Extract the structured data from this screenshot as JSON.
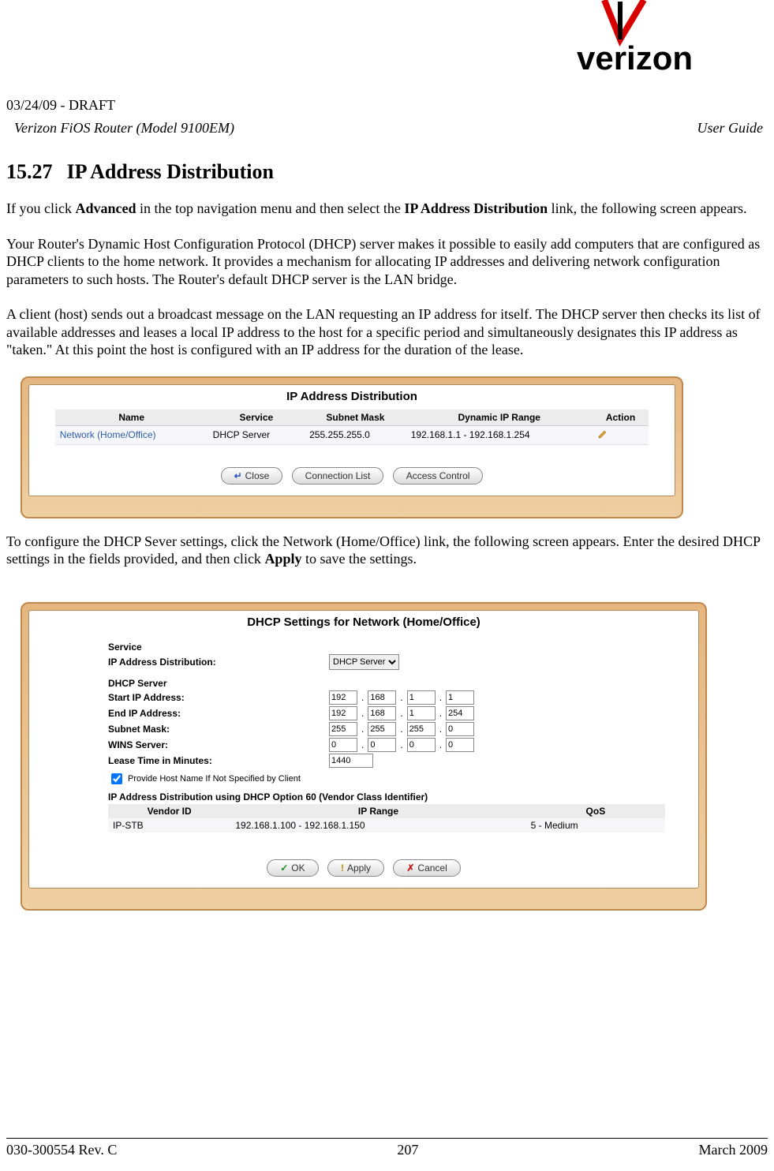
{
  "header": {
    "draft": "03/24/09 - DRAFT",
    "product": "Verizon FiOS Router (Model 9100EM)",
    "doc_type": "User Guide"
  },
  "section": {
    "number": "15.27",
    "title": "IP Address Distribution"
  },
  "body": {
    "p1a": "If you click ",
    "p1b": "Advanced",
    "p1c": " in the top navigation menu and then select the ",
    "p1d": "IP Address Distribution",
    "p1e": " link, the following screen appears.",
    "p2": "Your Router's Dynamic Host Configuration Protocol (DHCP) server makes it possible to easily add computers that are configured as DHCP clients to the home network. It provides a mechanism for allocating IP addresses and delivering network configuration parameters to such hosts. The Router's default DHCP server is the LAN bridge.",
    "p3": "A client (host) sends out a broadcast message on the LAN requesting an IP address for itself. The DHCP server then checks its list of available addresses and leases a local IP address to the host for a specific period and simultaneously designates this IP address as \"taken.\" At this point the host is configured with an IP address for the duration of the lease.",
    "p4a": "To configure the DHCP Sever settings, click the Network (Home/Office) link, the following screen appears. Enter the desired DHCP settings in the fields provided, and then click ",
    "p4b": "Apply",
    "p4c": " to save the settings."
  },
  "panel1": {
    "title": "IP Address Distribution",
    "columns": {
      "c1": "Name",
      "c2": "Service",
      "c3": "Subnet Mask",
      "c4": "Dynamic IP Range",
      "c5": "Action"
    },
    "row": {
      "name": "Network (Home/Office)",
      "service": "DHCP Server",
      "subnet": "255.255.255.0",
      "range": "192.168.1.1 - 192.168.1.254"
    },
    "buttons": {
      "close": "Close",
      "connlist": "Connection List",
      "access": "Access Control"
    }
  },
  "panel2": {
    "title": "DHCP Settings for Network (Home/Office)",
    "labels": {
      "service": "Service",
      "ipdist": "IP Address Distribution:",
      "dhcpserver": "DHCP Server",
      "startip": "Start IP Address:",
      "endip": "End IP Address:",
      "subnet": "Subnet Mask:",
      "wins": "WINS Server:",
      "lease": "Lease Time in Minutes:",
      "provide": "Provide Host Name If Not Specified by Client",
      "opt60head": "IP Address Distribution using DHCP Option 60 (Vendor Class Identifier)",
      "vendor": "Vendor ID",
      "iprange": "IP Range",
      "qos": "QoS"
    },
    "values": {
      "dhcp_select": "DHCP Server",
      "start": [
        "192",
        "168",
        "1",
        "1"
      ],
      "end": [
        "192",
        "168",
        "1",
        "254"
      ],
      "subnet": [
        "255",
        "255",
        "255",
        "0"
      ],
      "wins": [
        "0",
        "0",
        "0",
        "0"
      ],
      "lease": "1440",
      "provide_checked": true,
      "opt60": {
        "vendor": "IP-STB",
        "range": "192.168.1.100 - 192.168.1.150",
        "qos": "5 - Medium"
      }
    },
    "buttons": {
      "ok": "OK",
      "apply": "Apply",
      "cancel": "Cancel"
    }
  },
  "footer": {
    "rev": "030-300554 Rev. C",
    "page": "207",
    "date": "March 2009"
  }
}
